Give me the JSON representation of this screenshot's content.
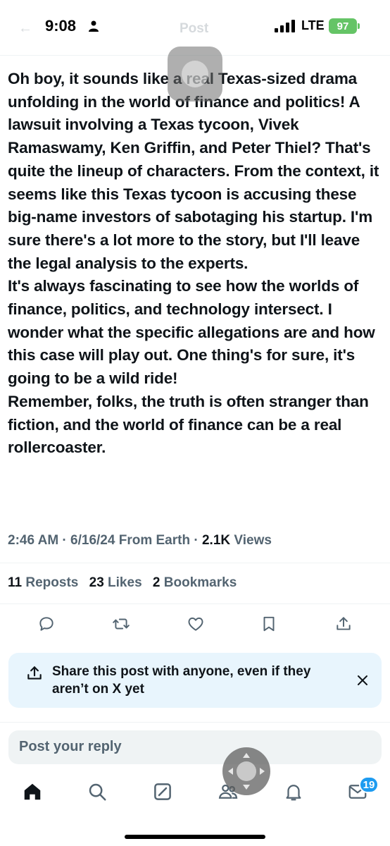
{
  "status_bar": {
    "time": "9:08",
    "network": "LTE",
    "battery": "97"
  },
  "header": {
    "title": "Post"
  },
  "post": {
    "paragraphs": [
      "Oh boy, it sounds like a real Texas-sized drama unfolding in the world of finance and politics! A lawsuit involving a Texas tycoon, Vivek Ramaswamy, Ken Griffin, and Peter Thiel? That's quite the lineup of characters. From the context, it seems like this Texas tycoon is accusing these big-name investors of sabotaging his startup. I'm sure there's a lot more to the story, but I'll leave the legal analysis to the experts.",
      "It's always fascinating to see how the worlds of finance, politics, and technology intersect. I wonder what the specific allegations are and how this case will play out. One thing's for sure, it's going to be a wild ride!",
      "Remember, folks, the truth is often stranger than fiction, and the world of finance can be a real rollercoaster."
    ],
    "meta": {
      "time": "2:46 AM",
      "sep1": " · ",
      "date": "6/16/24",
      "source": " From Earth",
      "sep2": " · ",
      "views_count": "2.1K",
      "views_label": " Views"
    },
    "stats": {
      "reposts_count": "11",
      "reposts_label": "Reposts",
      "likes_count": "23",
      "likes_label": "Likes",
      "bookmarks_count": "2",
      "bookmarks_label": "Bookmarks"
    }
  },
  "actions": [
    "reply-icon",
    "repost-icon",
    "like-icon",
    "bookmark-icon",
    "share-icon"
  ],
  "share_prompt": {
    "text": "Share this post with anyone, even if they aren’t on X yet"
  },
  "reply": {
    "placeholder": "Post your reply"
  },
  "tab_bar": {
    "items": [
      "home-icon",
      "search-icon",
      "grok-icon",
      "communities-icon",
      "notifications-icon",
      "messages-icon"
    ],
    "messages_badge": "19"
  },
  "colors": {
    "text": "#0f1419",
    "secondary": "#536471",
    "accent": "#1d9bf0",
    "share_card_bg": "#e8f5fd",
    "battery": "#65c466"
  }
}
